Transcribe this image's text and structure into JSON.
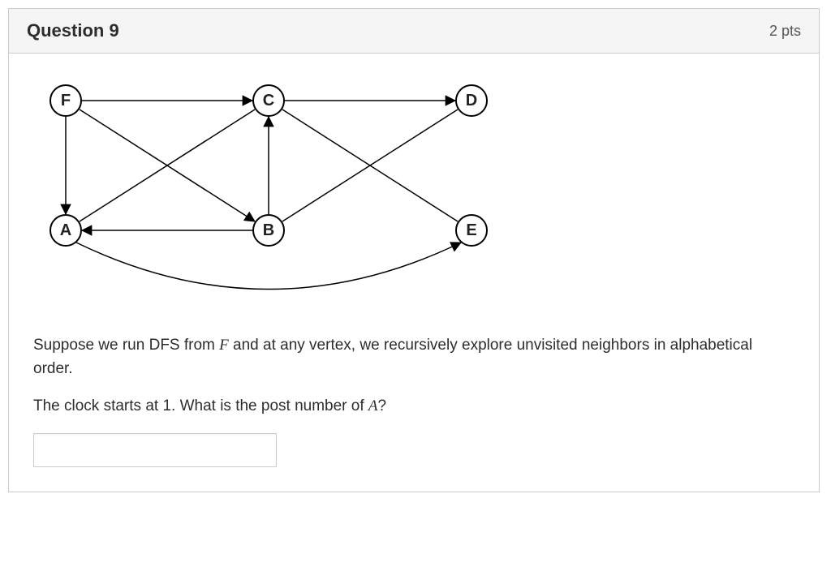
{
  "header": {
    "title": "Question 9",
    "points": "2 pts"
  },
  "graph": {
    "nodes": {
      "F": "F",
      "C": "C",
      "D": "D",
      "A": "A",
      "B": "B",
      "E": "E"
    }
  },
  "prompt": {
    "line1_pre": "Suppose we run DFS from ",
    "line1_var": "F",
    "line1_post": " and at any vertex, we recursively explore unvisited neighbors in alphabetical order.",
    "line2_pre": "The clock starts at 1. What is the post number of ",
    "line2_var": "A",
    "line2_post": "?"
  },
  "answer": {
    "value": "",
    "placeholder": ""
  }
}
